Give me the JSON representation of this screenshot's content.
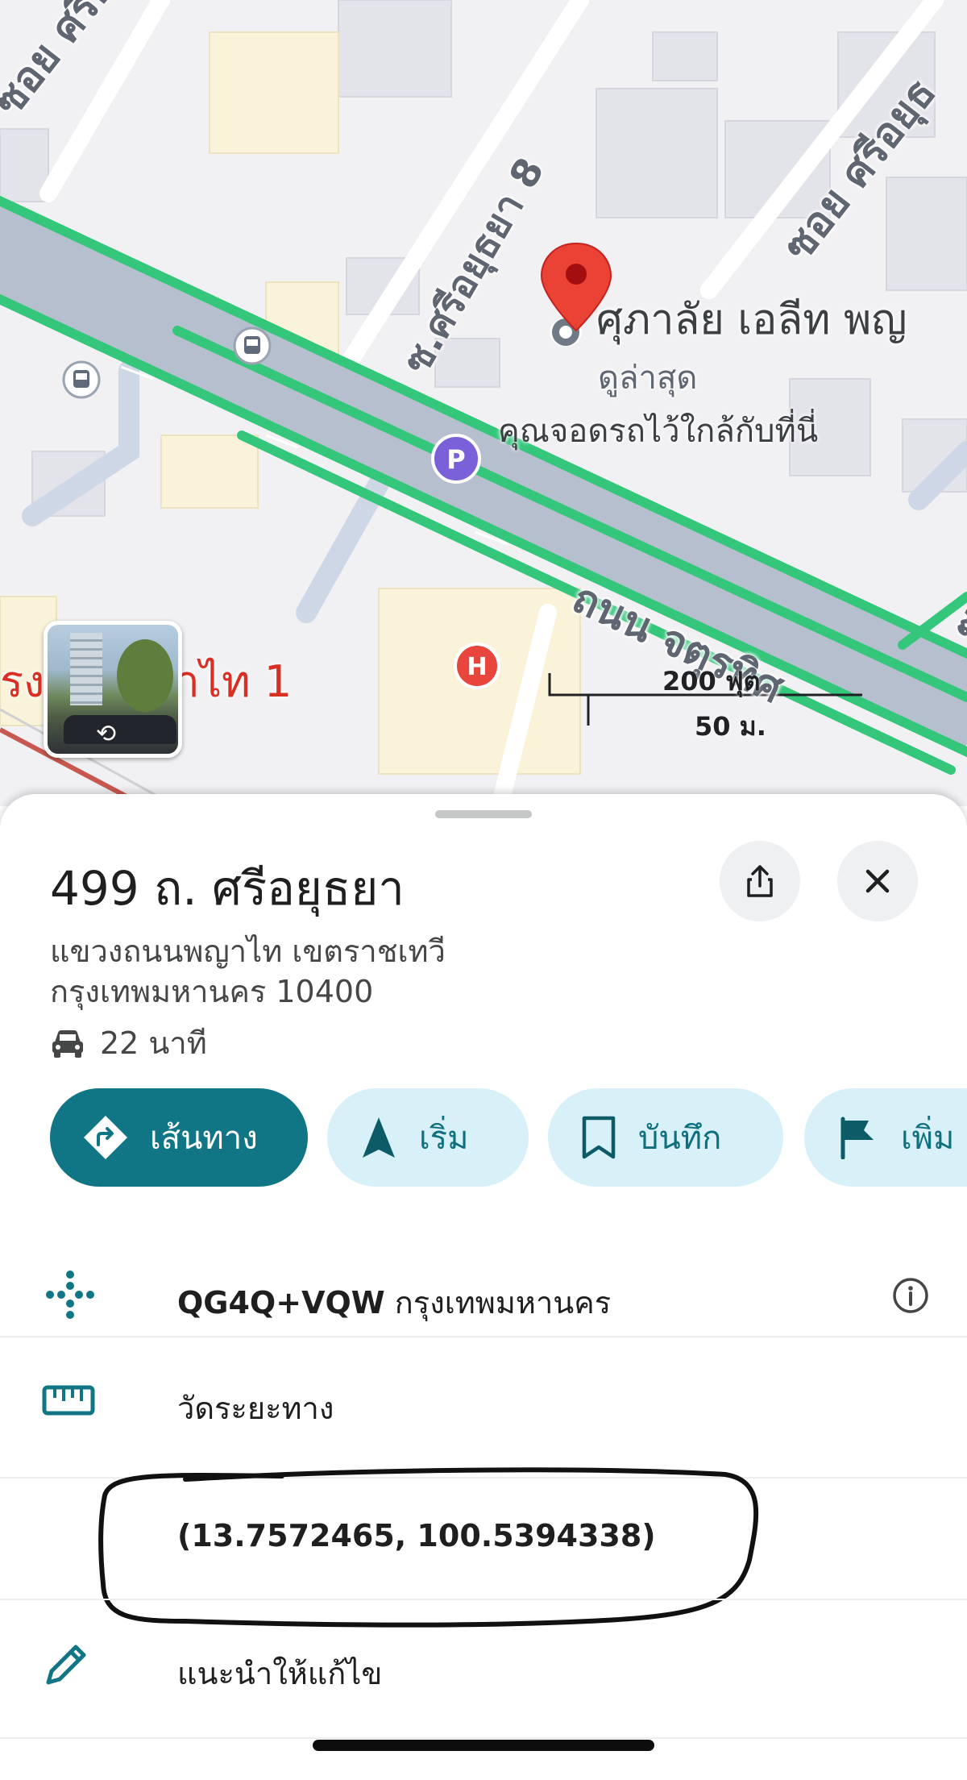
{
  "map": {
    "road_labels": {
      "soi_top_left": "ซอย ศรีอยุธ",
      "soi_8": "ซ.ศรีอยุธยา 8",
      "soi_right": "ซอย ศรีอยุธ",
      "main_road": "ถนน จตุรทิศ",
      "right_edge": "ซ"
    },
    "poi": {
      "title": "ศุภาลัย เอลีท พญ",
      "subtitle": "ดูล่าสุด",
      "parking_note": "คุณจอดรถไว้ใกล้กับที่นี่"
    },
    "hospital_label": "รง      าลพญาไท 1",
    "scale": {
      "feet": "200 ฟุต",
      "meters": "50 ม."
    },
    "icons": {
      "pin": "location-pin-icon",
      "parking": "parking-icon",
      "bus": "bus-icon",
      "hospital": "hospital-icon",
      "street_view": "street-view-rotate-icon"
    },
    "colors": {
      "road_green": "#34c77b",
      "pin_red": "#ea4335",
      "parking_purple": "#7b61d9",
      "hospital_red": "#e8453c"
    }
  },
  "sheet": {
    "title": "499 ถ. ศรีอยุธยา",
    "address_line1": "แขวงถนนพญาไท เขตราชเทวี",
    "address_line2": "กรุงเทพมหานคร 10400",
    "eta": "22 นาที",
    "actions": {
      "directions": "เส้นทาง",
      "start": "เริ่ม",
      "save": "บันทึก",
      "add": "เพิ่ม"
    },
    "rows": {
      "plus_code_bold": "QG4Q+VQW",
      "plus_code_city": " กรุงเทพมหานคร",
      "measure": "วัดระยะทาง",
      "coordinates": "(13.7572465, 100.5394338)",
      "suggest_edit": "แนะนำให้แก้ไข"
    },
    "colors": {
      "teal": "#107585",
      "chip_bg": "#d8f1f8"
    }
  }
}
